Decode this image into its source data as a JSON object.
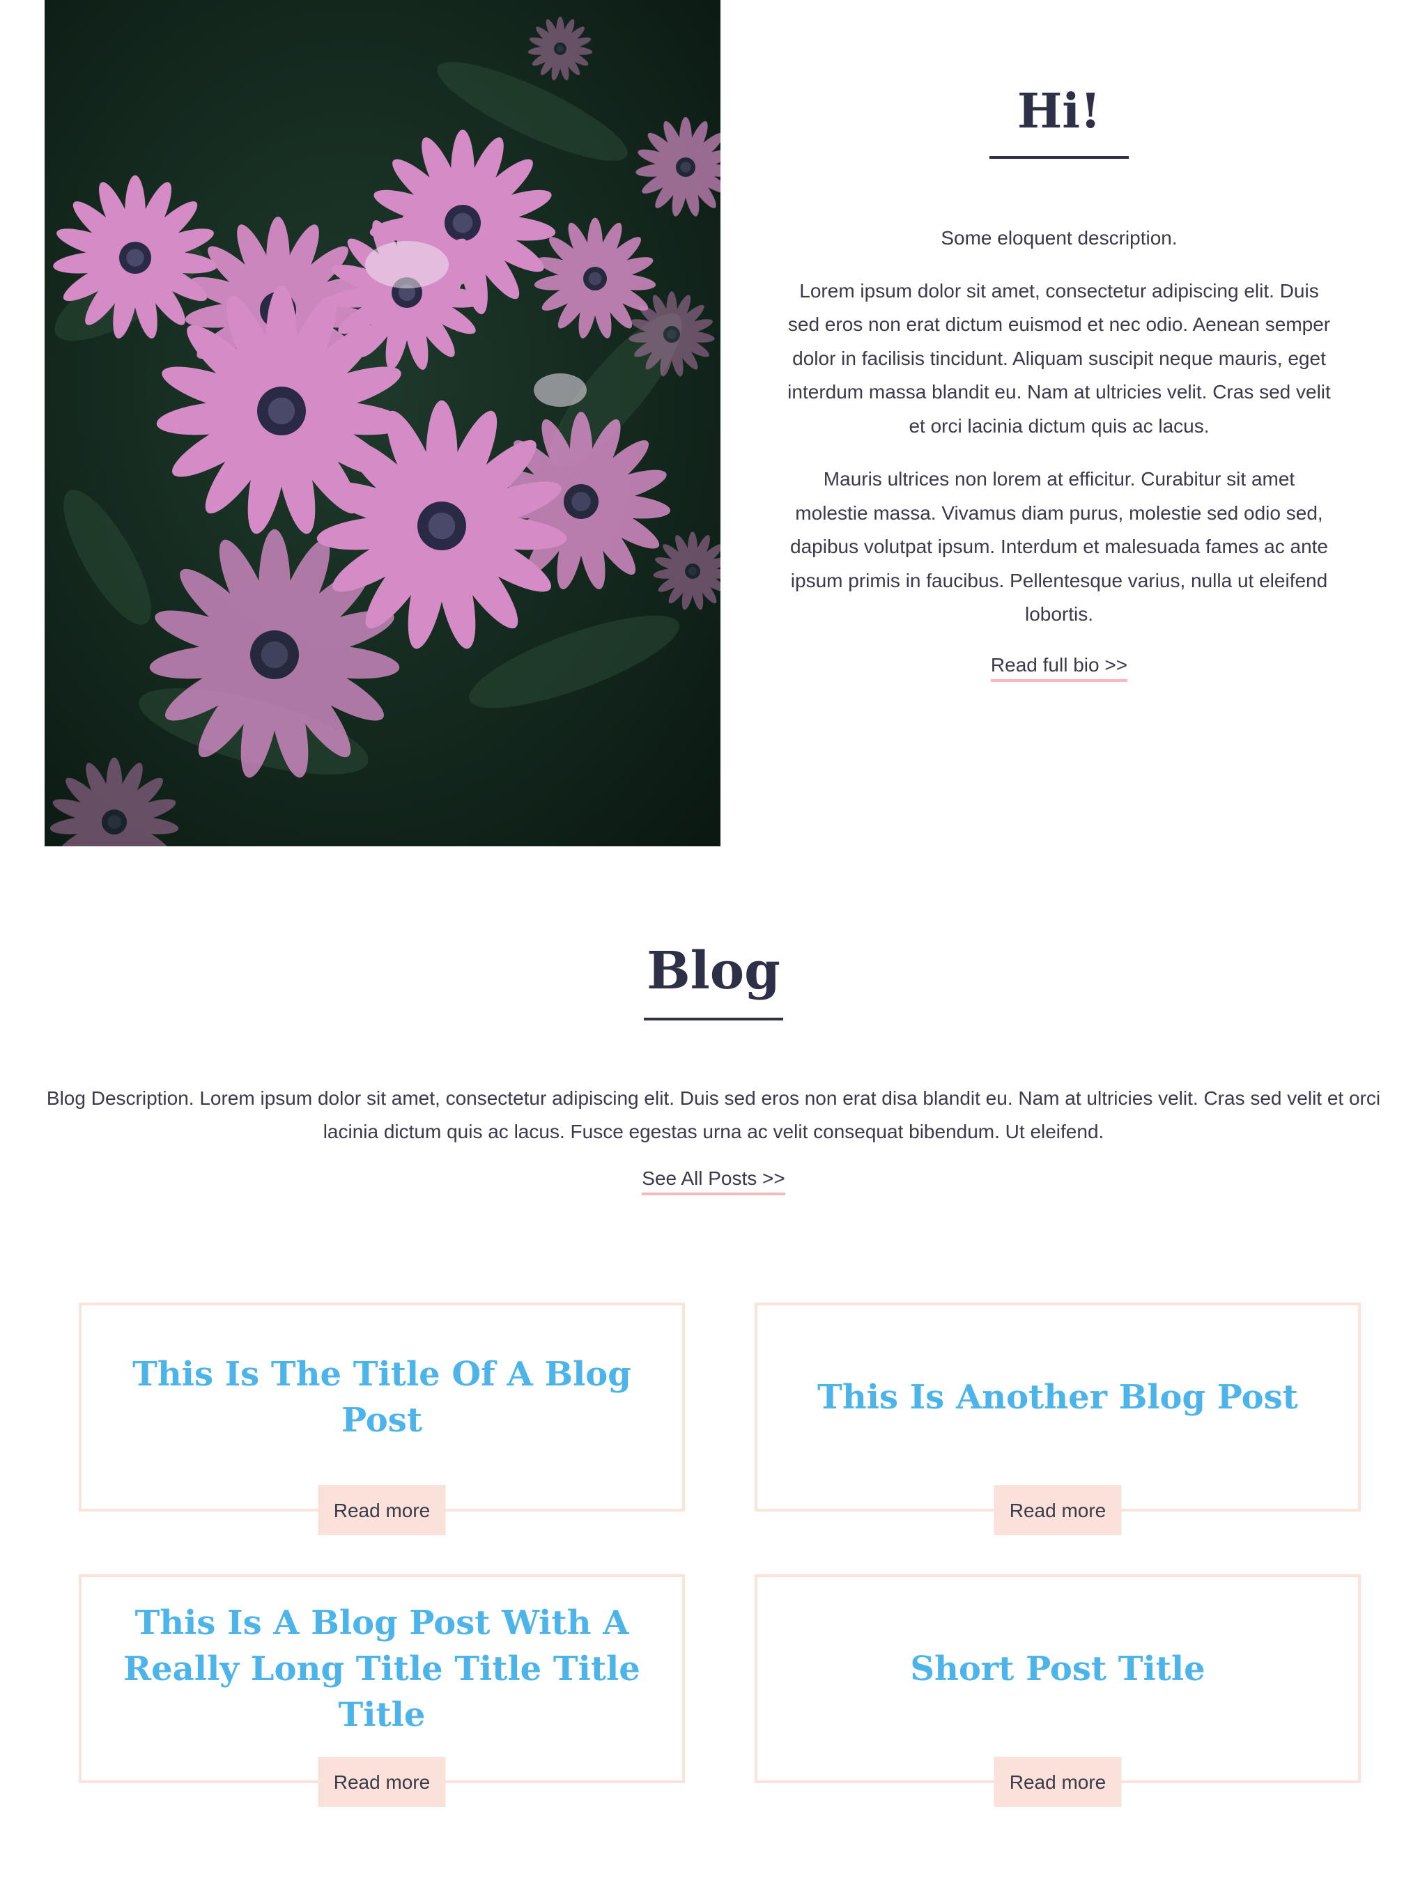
{
  "about": {
    "title": "Hi!",
    "intro": "Some eloquent description.",
    "paragraphs": [
      "Lorem ipsum dolor sit amet, consectetur adipiscing elit. Duis sed eros non erat dictum euismod et nec odio. Aenean semper dolor in facilisis tincidunt. Aliquam suscipit neque mauris, eget interdum massa blandit eu. Nam at ultricies velit. Cras sed velit et orci lacinia dictum quis ac lacus.",
      "Mauris ultrices non lorem at efficitur. Curabitur sit amet molestie massa. Vivamus diam purus, molestie sed odio sed, dapibus volutpat ipsum. Interdum et malesuada fames ac ante ipsum primis in faucibus. Pellentesque varius, nulla ut eleifend lobortis."
    ],
    "link_label": "Read full bio >>"
  },
  "blog": {
    "title": "Blog",
    "description": "Blog Description. Lorem ipsum dolor sit amet, consectetur adipiscing elit. Duis sed eros non erat disa blandit eu. Nam at ultricies velit. Cras sed velit et orci lacinia dictum quis ac lacus. Fusce egestas urna ac velit consequat bibendum. Ut eleifend.",
    "link_label": "See All Posts >>",
    "posts": [
      {
        "title": "This Is The Title Of A Blog Post",
        "button_label": "Read more"
      },
      {
        "title": "This Is Another Blog Post",
        "button_label": "Read more"
      },
      {
        "title": "This Is A Blog Post With A Really Long Title Title Title Title",
        "button_label": "Read more"
      },
      {
        "title": "Short Post Title",
        "button_label": "Read more"
      }
    ]
  },
  "colors": {
    "heading": "#2e3047",
    "body_text": "#3a3a4a",
    "post_title": "#4db4ea",
    "card_border": "#fbe3dc",
    "button_bg": "#fae1d9",
    "link_underline": "#f7b8bc"
  }
}
